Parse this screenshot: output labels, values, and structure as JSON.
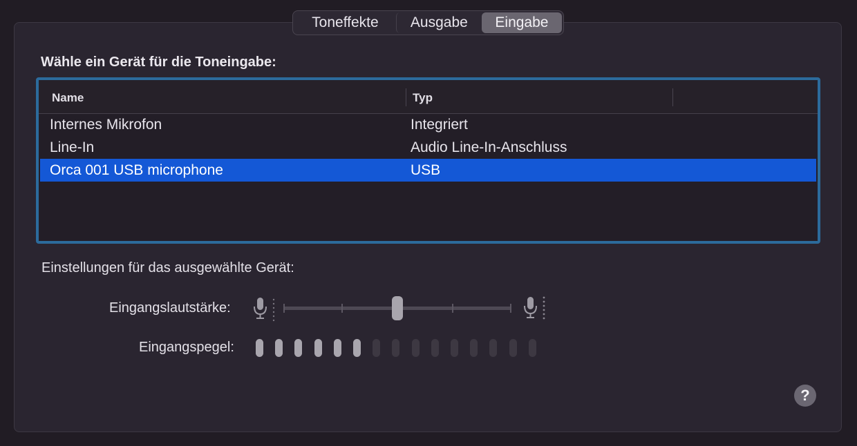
{
  "tabs": [
    {
      "label": "Toneffekte",
      "selected": false
    },
    {
      "label": "Ausgabe",
      "selected": false
    },
    {
      "label": "Eingabe",
      "selected": true
    }
  ],
  "input_section": {
    "title": "Wähle ein Gerät für die Toneingabe:",
    "columns": [
      "Name",
      "Typ"
    ],
    "devices": [
      {
        "name": "Internes Mikrofon",
        "type": "Integriert",
        "selected": false
      },
      {
        "name": "Line-In",
        "type": "Audio Line-In-Anschluss",
        "selected": false
      },
      {
        "name": "Orca 001 USB microphone",
        "type": "USB",
        "selected": true
      }
    ]
  },
  "device_settings": {
    "label": "Einstellungen für das ausgewählte Gerät:",
    "input_volume": {
      "label": "Eingangslautstärke:",
      "value_fraction": 0.5
    },
    "input_level": {
      "label": "Eingangspegel:",
      "active_segments": 6,
      "total_segments": 15
    }
  },
  "help_button": {
    "label": "?"
  },
  "colors": {
    "selection": "#1458d6",
    "focus_ring": "#2c6b9c",
    "background": "#2a2530"
  },
  "icons": [
    "microphone-low-icon",
    "microphone-high-icon",
    "help-icon"
  ]
}
